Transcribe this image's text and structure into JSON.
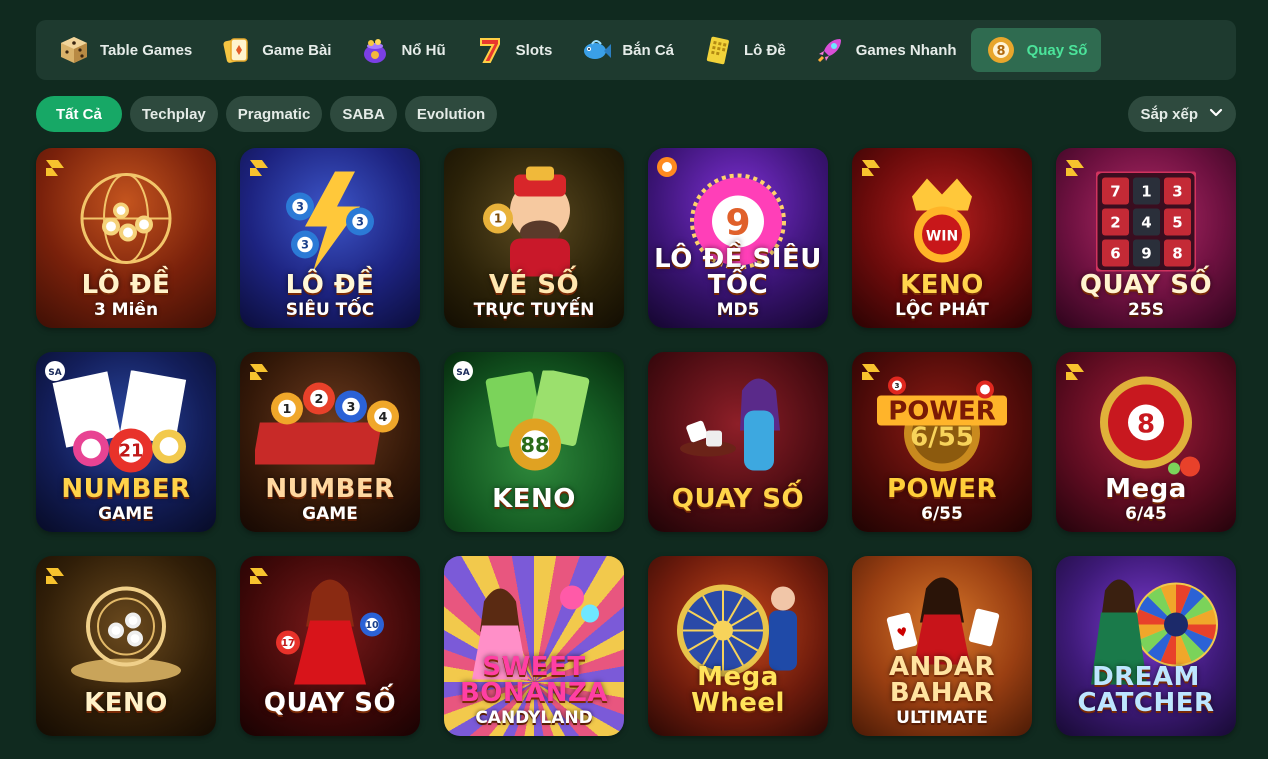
{
  "tabs": [
    {
      "label": "Table Games",
      "icon": "dice-icon",
      "active": false
    },
    {
      "label": "Game Bài",
      "icon": "cards-icon",
      "active": false
    },
    {
      "label": "Nổ Hũ",
      "icon": "jackpot-pot-icon",
      "active": false
    },
    {
      "label": "Slots",
      "icon": "lucky-seven-icon",
      "active": false
    },
    {
      "label": "Bắn Cá",
      "icon": "fish-icon",
      "active": false
    },
    {
      "label": "Lô Đề",
      "icon": "lottery-ticket-icon",
      "active": false
    },
    {
      "label": "Games Nhanh",
      "icon": "rocket-icon",
      "active": false
    },
    {
      "label": "Quay Số",
      "icon": "lottery-ball-icon",
      "active": true
    }
  ],
  "filters": {
    "chips": [
      "Tất Cả",
      "Techplay",
      "Pragmatic",
      "SABA",
      "Evolution"
    ],
    "active": "Tất Cả",
    "sort_label": "Sắp xếp"
  },
  "games": [
    {
      "title": "LÔ ĐỀ",
      "subtitle": "3 Miền",
      "theme": "lode3mien",
      "badge": "techplay"
    },
    {
      "title": "LÔ ĐỀ",
      "subtitle": "SIÊU TỐC",
      "theme": "lodesieutoc",
      "badge": "techplay"
    },
    {
      "title": "VÉ SỐ",
      "subtitle": "TRỰC TUYẾN",
      "theme": "veso",
      "badge": ""
    },
    {
      "title": "LÔ ĐỀ SIÊU TỐC",
      "subtitle": "MD5",
      "theme": "lodemd5",
      "badge": "orange"
    },
    {
      "title": "KENO",
      "subtitle": "LỘC PHÁT",
      "theme": "kenolocphat",
      "badge": "techplay"
    },
    {
      "title": "QUAY SỐ",
      "subtitle": "25S",
      "theme": "quayso25",
      "badge": "techplay"
    },
    {
      "title": "NUMBER",
      "subtitle": "GAME",
      "theme": "number1",
      "badge": "saba"
    },
    {
      "title": "NUMBER",
      "subtitle": "GAME",
      "theme": "number2",
      "badge": "techplay"
    },
    {
      "title": "KENO",
      "subtitle": "",
      "theme": "keno1",
      "badge": "saba"
    },
    {
      "title": "QUAY SỐ",
      "subtitle": "",
      "theme": "quayso1",
      "badge": ""
    },
    {
      "title": "POWER",
      "subtitle": "6/55",
      "theme": "power",
      "badge": "techplay"
    },
    {
      "title": "Mega",
      "subtitle": "6/45",
      "theme": "mega",
      "badge": "techplay"
    },
    {
      "title": "KENO",
      "subtitle": "",
      "theme": "keno2",
      "badge": "techplay"
    },
    {
      "title": "QUAY SỐ",
      "subtitle": "",
      "theme": "quayso2",
      "badge": "techplay"
    },
    {
      "title": "SWEET BONANZA",
      "subtitle": "CANDYLAND",
      "theme": "bonanza",
      "badge": ""
    },
    {
      "title": "Mega Wheel",
      "subtitle": "",
      "theme": "megawheel",
      "badge": ""
    },
    {
      "title": "ANDAR BAHAR",
      "subtitle": "ULTIMATE",
      "theme": "andar",
      "badge": ""
    },
    {
      "title": "DREAM CATCHER",
      "subtitle": "",
      "theme": "dream",
      "badge": ""
    }
  ]
}
